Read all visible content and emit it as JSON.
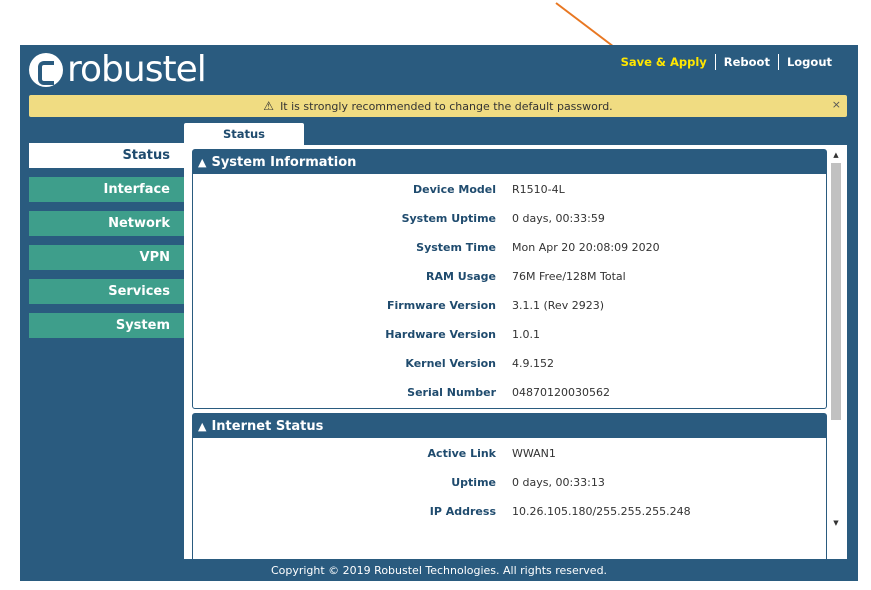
{
  "header": {
    "logo_text": "robustel",
    "nav": {
      "save": "Save & Apply",
      "reboot": "Reboot",
      "logout": "Logout"
    }
  },
  "warning": {
    "icon": "warning-triangle-icon",
    "text": "It is strongly recommended to change the default password.",
    "close": "×"
  },
  "sidebar": {
    "items": [
      {
        "label": "Status"
      },
      {
        "label": "Interface"
      },
      {
        "label": "Network"
      },
      {
        "label": "VPN"
      },
      {
        "label": "Services"
      },
      {
        "label": "System"
      }
    ]
  },
  "tabs": [
    {
      "label": "Status"
    }
  ],
  "system_info": {
    "title": "System Information",
    "rows": [
      {
        "label": "Device Model",
        "value": "R1510-4L"
      },
      {
        "label": "System Uptime",
        "value": "0 days, 00:33:59"
      },
      {
        "label": "System Time",
        "value": "Mon Apr 20 20:08:09 2020"
      },
      {
        "label": "RAM Usage",
        "value": "76M Free/128M Total"
      },
      {
        "label": "Firmware Version",
        "value": "3.1.1 (Rev 2923)"
      },
      {
        "label": "Hardware Version",
        "value": "1.0.1"
      },
      {
        "label": "Kernel Version",
        "value": "4.9.152"
      },
      {
        "label": "Serial Number",
        "value": "04870120030562"
      }
    ]
  },
  "internet_status": {
    "title": "Internet Status",
    "rows": [
      {
        "label": "Active Link",
        "value": "WWAN1"
      },
      {
        "label": "Uptime",
        "value": "0 days, 00:33:13"
      },
      {
        "label": "IP Address",
        "value": "10.26.105.180/255.255.255.248"
      }
    ]
  },
  "footer": {
    "text": "Copyright © 2019 Robustel Technologies. All rights reserved."
  },
  "colors": {
    "primary": "#2a5b7f",
    "nav_green": "#3e9e8b",
    "warning_bg": "#f0dc82",
    "save_highlight": "#ffe600",
    "arrow": "#e87722"
  }
}
